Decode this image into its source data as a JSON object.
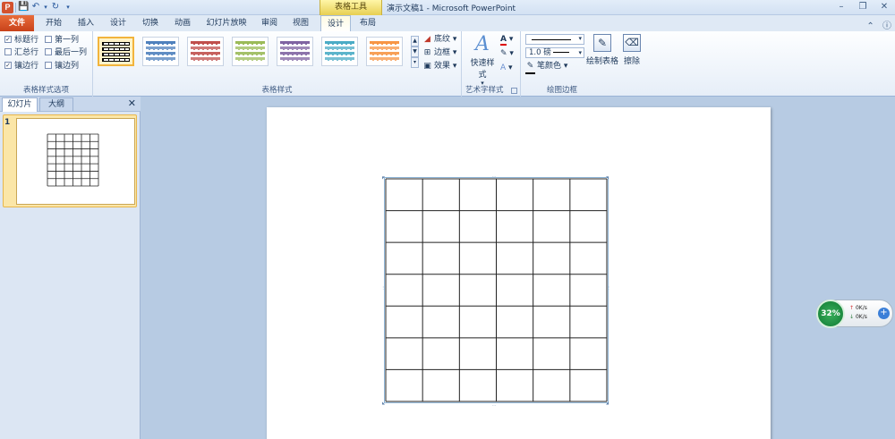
{
  "window": {
    "title": "演示文稿1 - Microsoft PowerPoint",
    "contextual_header": "表格工具",
    "app_logo": "P"
  },
  "quick_access": {
    "icons": [
      "save-icon",
      "undo-icon",
      "redo-icon",
      "customize-icon"
    ]
  },
  "tabs": [
    {
      "label": "文件"
    },
    {
      "label": "开始"
    },
    {
      "label": "插入"
    },
    {
      "label": "设计"
    },
    {
      "label": "切换"
    },
    {
      "label": "动画"
    },
    {
      "label": "幻灯片放映"
    },
    {
      "label": "审阅"
    },
    {
      "label": "视图"
    },
    {
      "label": "设计"
    },
    {
      "label": "布局"
    }
  ],
  "ribbon": {
    "table_style_options": {
      "label": "表格样式选项",
      "options": [
        {
          "label": "标题行",
          "checked": true
        },
        {
          "label": "第一列",
          "checked": false
        },
        {
          "label": "汇总行",
          "checked": false
        },
        {
          "label": "最后一列",
          "checked": false
        },
        {
          "label": "镶边行",
          "checked": true
        },
        {
          "label": "镶边列",
          "checked": false
        }
      ]
    },
    "table_styles": {
      "label": "表格样式",
      "swatches": [
        "#6d6d6d",
        "#4f81bd",
        "#c0504d",
        "#9bbb59",
        "#8064a2",
        "#4bacc6",
        "#f79646"
      ],
      "shading": "底纹",
      "borders": "边框",
      "effects": "效果"
    },
    "wordart": {
      "label": "艺术字样式",
      "quick_styles": "快速样式"
    },
    "draw_borders": {
      "label": "绘图边框",
      "pen_weight": "1.0 磅",
      "pen_color": "笔颜色",
      "draw_table": "绘制表格",
      "eraser": "擦除"
    }
  },
  "slides_pane": {
    "tabs": [
      "幻灯片",
      "大纲"
    ],
    "slide_number": "1"
  },
  "table": {
    "rows": 7,
    "cols": 6
  },
  "net_monitor": {
    "percent": "32%",
    "upload": "0K/s",
    "download": "0K/s"
  }
}
